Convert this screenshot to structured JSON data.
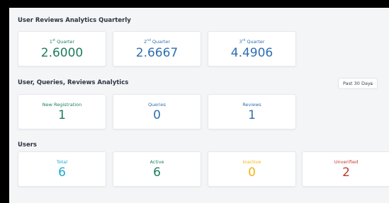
{
  "sections": {
    "quarterly_title": "User Reviews Analytics Quarterly",
    "activity_title": "User, Queries, Reviews Analytics",
    "users_title": "Users"
  },
  "quarters": [
    {
      "ordinal": "1",
      "suffix": "st",
      "word": " Quarter",
      "value": "2.6000",
      "color": "#1e7d5b"
    },
    {
      "ordinal": "2",
      "suffix": "nd",
      "word": " Quarter",
      "value": "2.6667",
      "color": "#2f6fb3"
    },
    {
      "ordinal": "3",
      "suffix": "rd",
      "word": " Quarter",
      "value": "4.4906",
      "color": "#2f6fb3"
    }
  ],
  "period_filter": {
    "selected": "Past 30 Days",
    "icon": "chevron-down-icon"
  },
  "activity": [
    {
      "label": "New Registration",
      "value": "1",
      "label_color": "#1e7d5b",
      "value_color": "#1e7d5b"
    },
    {
      "label": "Queries",
      "value": "0",
      "label_color": "#2f6fb3",
      "value_color": "#2f6fb3"
    },
    {
      "label": "Reviews",
      "value": "1",
      "label_color": "#2f6fb3",
      "value_color": "#2f6fb3"
    }
  ],
  "users": [
    {
      "label": "Total",
      "value": "6",
      "color": "#1ea9c9"
    },
    {
      "label": "Active",
      "value": "6",
      "color": "#1e7d5b"
    },
    {
      "label": "Inactive",
      "value": "0",
      "color": "#f2b410"
    },
    {
      "label": "Unverified",
      "value": "2",
      "color": "#c0392b"
    }
  ]
}
